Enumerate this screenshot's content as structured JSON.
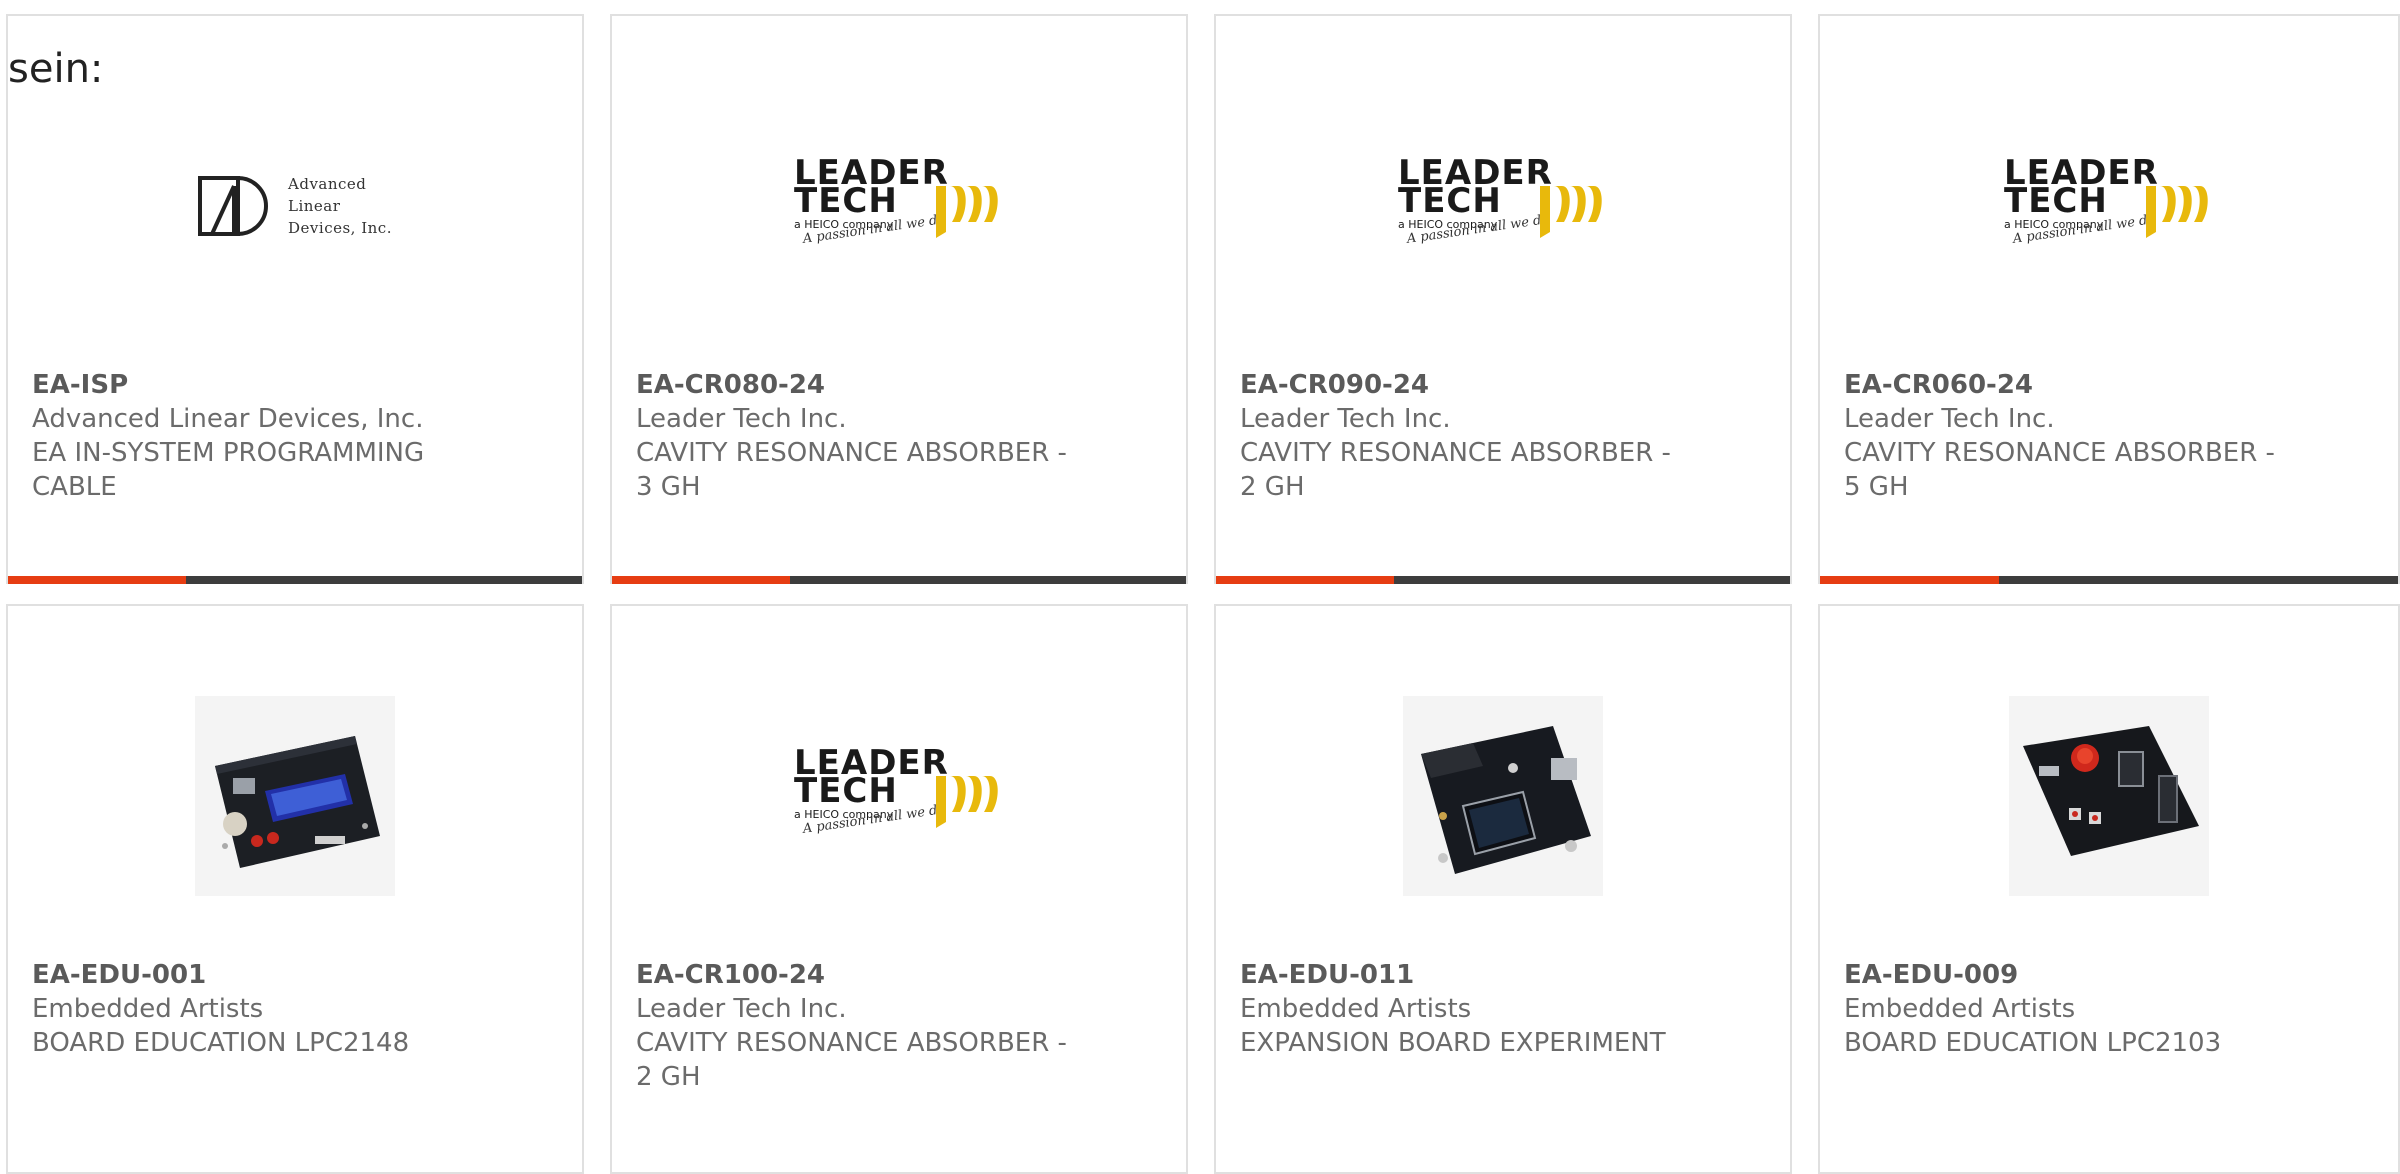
{
  "lead_text": "sein:",
  "colors": {
    "accent": "#e63d12",
    "bar_track": "#3d3d3d",
    "logo_yellow": "#e8b90c"
  },
  "products": [
    {
      "sku": "EA-ISP",
      "manufacturer": "Advanced Linear Devices, Inc.",
      "description": "EA IN-SYSTEM PROGRAMMING CABLE",
      "image": "ald-logo",
      "logo_text": [
        "Advanced",
        "Linear",
        "Devices, Inc."
      ],
      "progress": 0.31
    },
    {
      "sku": "EA-CR080-24",
      "manufacturer": "Leader Tech Inc.",
      "description": "CAVITY RESONANCE ABSORBER - 3 GH",
      "image": "leader-tech-logo",
      "logo_text": [
        "LEADER",
        "TECH",
        "a HEICO company",
        "A passion in all we do"
      ],
      "progress": 0.31
    },
    {
      "sku": "EA-CR090-24",
      "manufacturer": "Leader Tech Inc.",
      "description": "CAVITY RESONANCE ABSORBER - 2 GH",
      "image": "leader-tech-logo",
      "logo_text": [
        "LEADER",
        "TECH",
        "a HEICO company",
        "A passion in all we do"
      ],
      "progress": 0.31
    },
    {
      "sku": "EA-CR060-24",
      "manufacturer": "Leader Tech Inc.",
      "description": "CAVITY RESONANCE ABSORBER - 5 GH",
      "image": "leader-tech-logo",
      "logo_text": [
        "LEADER",
        "TECH",
        "a HEICO company",
        "A passion in all we do"
      ],
      "progress": 0.31
    },
    {
      "sku": "EA-EDU-001",
      "manufacturer": "Embedded Artists",
      "description": "BOARD EDUCATION LPC2148",
      "image": "board-lcd"
    },
    {
      "sku": "EA-CR100-24",
      "manufacturer": "Leader Tech Inc.",
      "description": "CAVITY RESONANCE ABSORBER - 2 GH",
      "image": "leader-tech-logo",
      "logo_text": [
        "LEADER",
        "TECH",
        "a HEICO company",
        "A passion in all we do"
      ]
    },
    {
      "sku": "EA-EDU-011",
      "manufacturer": "Embedded Artists",
      "description": "EXPANSION BOARD EXPERIMENT",
      "image": "board-expansion"
    },
    {
      "sku": "EA-EDU-009",
      "manufacturer": "Embedded Artists",
      "description": "BOARD EDUCATION LPC2103",
      "image": "board-segment"
    }
  ]
}
